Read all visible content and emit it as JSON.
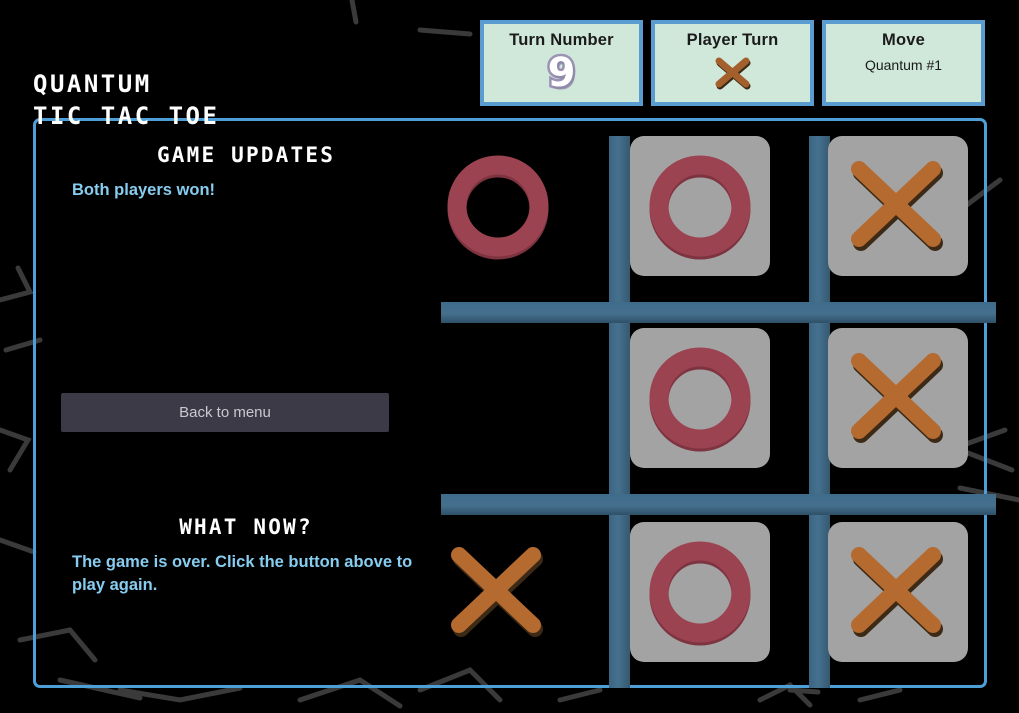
{
  "app": {
    "title_line1": "QUANTUM",
    "title_line2": "TIC TAC TOE"
  },
  "colors": {
    "panel_bg": "#cfe8da",
    "panel_border": "#5a9bd0",
    "container_border": "#4e9fd8",
    "accent_text": "#86cdf0",
    "grid_bar": "#3f6c8b",
    "cell_bg": "#a3a3a3",
    "o_piece": "#9c4351",
    "x_piece": "#b56a30",
    "button_bg": "#3d3a47",
    "background": "#000000"
  },
  "header": {
    "panels": [
      {
        "title": "Turn Number",
        "value": "9",
        "value_kind": "digit",
        "icon": ""
      },
      {
        "title": "Player Turn",
        "value": "",
        "value_kind": "icon",
        "icon": "x-mark-icon"
      },
      {
        "title": "Move",
        "value": "Quantum #1",
        "value_kind": "text",
        "icon": ""
      }
    ]
  },
  "left_column": {
    "updates_heading": "GAME UPDATES",
    "updates_text": "Both players won!",
    "back_button_label": "Back to menu",
    "what_now_heading": "WHAT NOW?",
    "what_now_text": "The game is over. Click the button above to play again."
  },
  "board": {
    "rows": 3,
    "cols": 3,
    "cells": [
      {
        "row": 0,
        "col": 0,
        "mark": "O",
        "collapsed": false
      },
      {
        "row": 0,
        "col": 1,
        "mark": "O",
        "collapsed": true
      },
      {
        "row": 0,
        "col": 2,
        "mark": "X",
        "collapsed": true
      },
      {
        "row": 1,
        "col": 0,
        "mark": "",
        "collapsed": false
      },
      {
        "row": 1,
        "col": 1,
        "mark": "O",
        "collapsed": true
      },
      {
        "row": 1,
        "col": 2,
        "mark": "X",
        "collapsed": true
      },
      {
        "row": 2,
        "col": 0,
        "mark": "X",
        "collapsed": false
      },
      {
        "row": 2,
        "col": 1,
        "mark": "O",
        "collapsed": true
      },
      {
        "row": 2,
        "col": 2,
        "mark": "X",
        "collapsed": true
      }
    ]
  }
}
